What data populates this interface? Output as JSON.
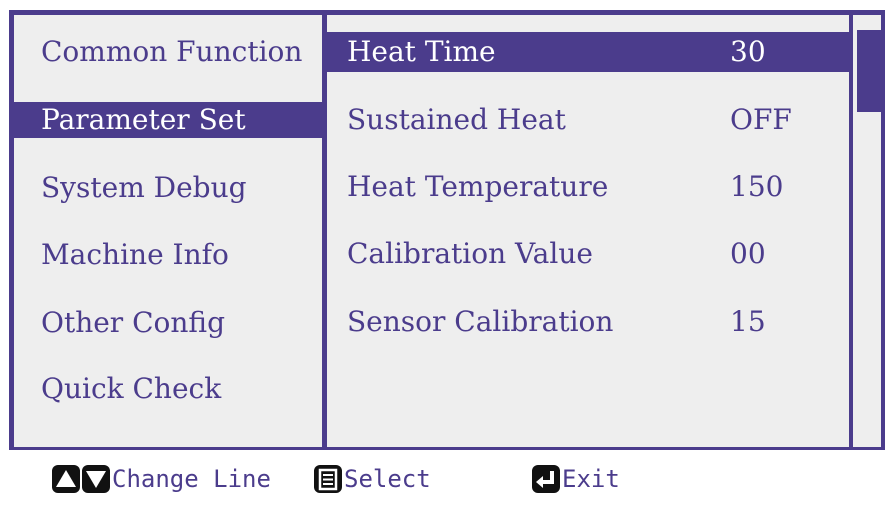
{
  "colors": {
    "accent": "#4b3c8c",
    "panel": "#eeeeee",
    "selected_text": "#ffffff",
    "icon": "#111111"
  },
  "menu": [
    {
      "label": "Common Function",
      "selected": false
    },
    {
      "label": "Parameter Set",
      "selected": true
    },
    {
      "label": "System Debug",
      "selected": false
    },
    {
      "label": "Machine Info",
      "selected": false
    },
    {
      "label": "Other Config",
      "selected": false
    },
    {
      "label": "Quick Check",
      "selected": false
    }
  ],
  "params": [
    {
      "label": "Heat Time",
      "value": "30",
      "selected": true
    },
    {
      "label": "Sustained Heat",
      "value": "OFF",
      "selected": false
    },
    {
      "label": "Heat Temperature",
      "value": "150",
      "selected": false
    },
    {
      "label": "Calibration Value",
      "value": "00",
      "selected": false
    },
    {
      "label": "Sensor Calibration",
      "value": "15",
      "selected": false
    }
  ],
  "footer": {
    "change_line": {
      "label": "Change Line",
      "icons": [
        "up-arrow-icon",
        "down-arrow-icon"
      ]
    },
    "select": {
      "label": "Select",
      "icon": "document-icon"
    },
    "exit": {
      "label": "Exit",
      "icon": "return-arrow-icon"
    }
  }
}
